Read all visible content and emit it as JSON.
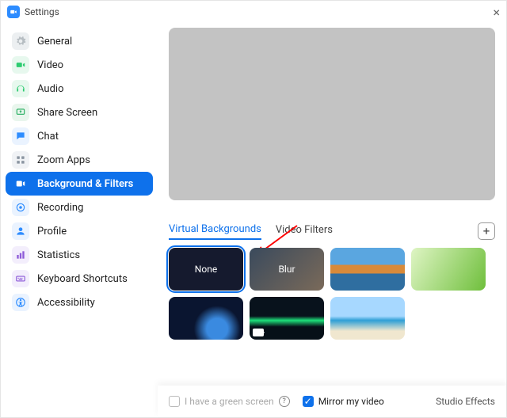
{
  "window": {
    "title": "Settings"
  },
  "sidebar": {
    "items": [
      {
        "label": "General",
        "icon_bg": "#eceff1",
        "icon_fg": "#b0b7bd",
        "icon": "gear"
      },
      {
        "label": "Video",
        "icon_bg": "#e7f8ee",
        "icon_fg": "#2ecc71",
        "icon": "camera"
      },
      {
        "label": "Audio",
        "icon_bg": "#e7f8ee",
        "icon_fg": "#2ecc71",
        "icon": "headphones"
      },
      {
        "label": "Share Screen",
        "icon_bg": "#e9f6ed",
        "icon_fg": "#27ae60",
        "icon": "share"
      },
      {
        "label": "Chat",
        "icon_bg": "#eaf3ff",
        "icon_fg": "#2d8cff",
        "icon": "chat"
      },
      {
        "label": "Zoom Apps",
        "icon_bg": "#f0f2f5",
        "icon_fg": "#8a94a0",
        "icon": "apps"
      },
      {
        "label": "Background & Filters",
        "icon_bg": "#0e71eb",
        "icon_fg": "#ffffff",
        "icon": "bgfilters",
        "active": true
      },
      {
        "label": "Recording",
        "icon_bg": "#eaf3ff",
        "icon_fg": "#2d8cff",
        "icon": "record"
      },
      {
        "label": "Profile",
        "icon_bg": "#eaf3ff",
        "icon_fg": "#2d8cff",
        "icon": "profile"
      },
      {
        "label": "Statistics",
        "icon_bg": "#f3eefc",
        "icon_fg": "#8e5cd9",
        "icon": "stats"
      },
      {
        "label": "Keyboard Shortcuts",
        "icon_bg": "#f3eefc",
        "icon_fg": "#8e5cd9",
        "icon": "keyboard"
      },
      {
        "label": "Accessibility",
        "icon_bg": "#eaf3ff",
        "icon_fg": "#2d8cff",
        "icon": "accessibility"
      }
    ]
  },
  "tabs": {
    "virtual_backgrounds": "Virtual Backgrounds",
    "video_filters": "Video Filters",
    "active": "virtual_backgrounds"
  },
  "thumbnails": [
    {
      "label": "None",
      "selected": true,
      "style": "background:#151a2e"
    },
    {
      "label": "Blur",
      "style": "background:linear-gradient(135deg,#3a4a5c,#7a6a5a)"
    },
    {
      "name": "golden-gate-bridge",
      "style": "background:linear-gradient(to bottom,#5aa6e0 40%,#d88a3a 40%,#d88a3a 60%,#2f6ea0 60%)"
    },
    {
      "name": "grass",
      "style": "background:linear-gradient(120deg,#dff5c4,#6fbf3c)"
    },
    {
      "name": "earth-space",
      "style": "background:radial-gradient(circle at 65% 75%,#3a8ae0 18%,#0a1530 40%)"
    },
    {
      "name": "aurora",
      "style": "background:linear-gradient(to bottom,#08121c 45%,#1de07a 55%,#061018 70%)",
      "has_cam": true
    },
    {
      "name": "beach",
      "style": "background:linear-gradient(to bottom,#a7d8ff 45%,#2e9fd6 55%,#f0e7cf 80%)"
    }
  ],
  "footer": {
    "green_screen": "I have a green screen",
    "mirror": "Mirror my video",
    "mirror_checked": true,
    "studio": "Studio Effects"
  }
}
